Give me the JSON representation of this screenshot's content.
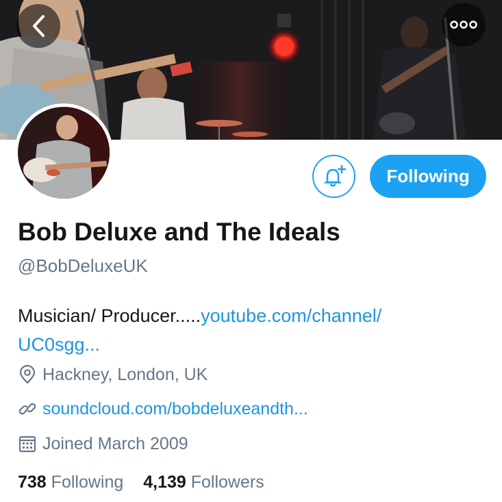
{
  "header": {
    "back_icon": "chevron-left-icon",
    "more_icon": "more-horizontal-icon"
  },
  "actions": {
    "notify_icon": "bell-plus-icon",
    "follow_label": "Following",
    "accent_color": "#1da1f2"
  },
  "profile": {
    "name": "Bob Deluxe and The Ideals",
    "handle": "@BobDeluxeUK",
    "bio_text": "Musician/ Producer.....",
    "bio_link_line1": "youtube.com/channel/",
    "bio_link_line2": "UC0sgg...",
    "location": "Hackney, London, UK",
    "website": "soundcloud.com/bobdeluxeandth...",
    "joined": "Joined March 2009"
  },
  "stats": {
    "following_count": "738",
    "following_label": "Following",
    "followers_count": "4,139",
    "followers_label": "Followers"
  }
}
